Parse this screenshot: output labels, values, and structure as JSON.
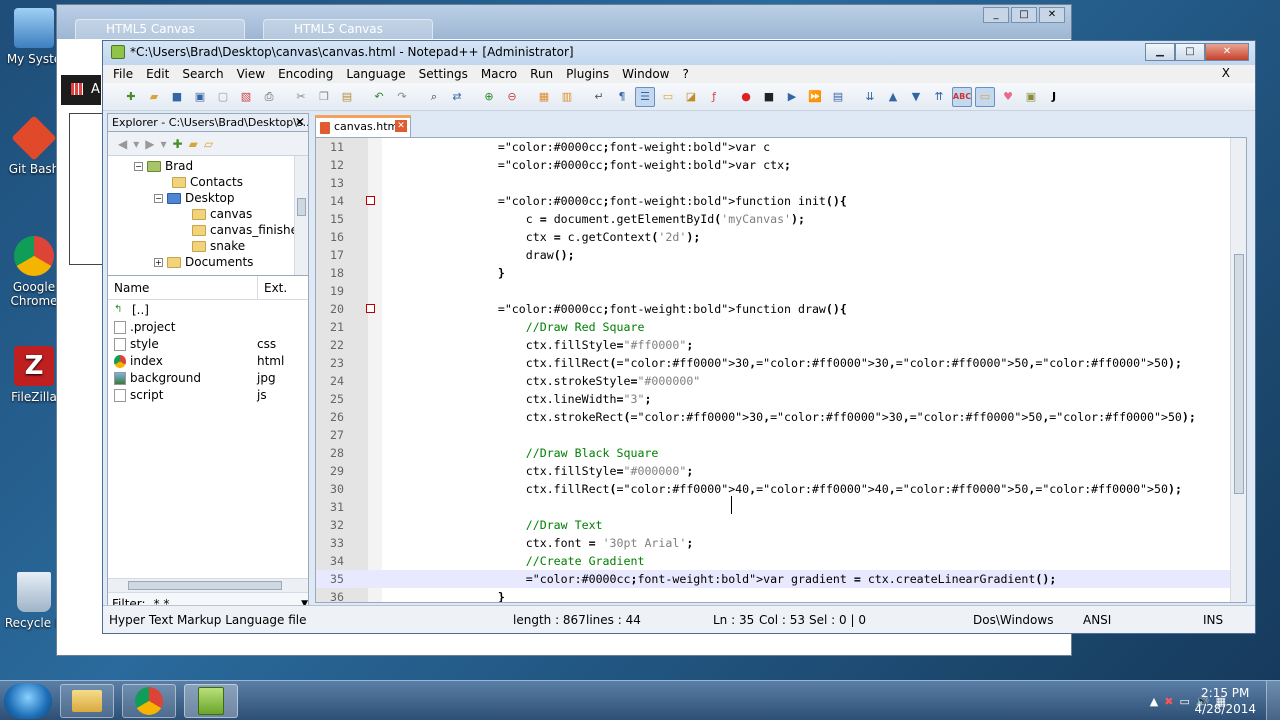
{
  "desktop": {
    "icons": [
      {
        "label": "My Syste",
        "icon": "computer-icon"
      },
      {
        "label": "Git Bash",
        "icon": "git-icon"
      },
      {
        "label": "Google Chrome",
        "icon": "chrome-icon"
      },
      {
        "label": "FileZilla",
        "icon": "filezilla-icon"
      },
      {
        "label": "Recycle B",
        "icon": "recycle-bin-icon"
      }
    ]
  },
  "browser": {
    "tab1": "HTML5 Canvas",
    "tab2": "HTML5 Canvas",
    "side_text": "Ap"
  },
  "npp": {
    "title": "*C:\\Users\\Brad\\Desktop\\canvas\\canvas.html - Notepad++ [Administrator]",
    "menus": [
      "File",
      "Edit",
      "Search",
      "View",
      "Encoding",
      "Language",
      "Settings",
      "Macro",
      "Run",
      "Plugins",
      "Window",
      "?"
    ],
    "menu_close": "X",
    "explorer": {
      "header": "Explorer - C:\\Users\\Brad\\Desktop\\s...",
      "tree": [
        {
          "label": "Brad",
          "level": 0
        },
        {
          "label": "Contacts",
          "level": 1
        },
        {
          "label": "Desktop",
          "level": 1
        },
        {
          "label": "canvas",
          "level": 2
        },
        {
          "label": "canvas_finished",
          "level": 2
        },
        {
          "label": "snake",
          "level": 2
        },
        {
          "label": "Documents",
          "level": 1
        }
      ],
      "col_name": "Name",
      "col_ext": "Ext.",
      "files": [
        {
          "name": "[..]",
          "ext": ""
        },
        {
          "name": ".project",
          "ext": ""
        },
        {
          "name": "style",
          "ext": "css"
        },
        {
          "name": "index",
          "ext": "html"
        },
        {
          "name": "background",
          "ext": "jpg"
        },
        {
          "name": "script",
          "ext": "js"
        }
      ],
      "filter_label": "Filter:",
      "filter_value": "*.*"
    },
    "tab": "canvas.html",
    "code": [
      {
        "n": "11",
        "t": "        var c"
      },
      {
        "n": "12",
        "t": "        var ctx;"
      },
      {
        "n": "13",
        "t": ""
      },
      {
        "n": "14",
        "t": "        function init(){"
      },
      {
        "n": "15",
        "t": "            c = document.getElementById('myCanvas');"
      },
      {
        "n": "16",
        "t": "            ctx = c.getContext('2d');"
      },
      {
        "n": "17",
        "t": "            draw();"
      },
      {
        "n": "18",
        "t": "        }"
      },
      {
        "n": "19",
        "t": ""
      },
      {
        "n": "20",
        "t": "        function draw(){"
      },
      {
        "n": "21",
        "t": "            //Draw Red Square"
      },
      {
        "n": "22",
        "t": "            ctx.fillStyle=\"#ff0000\";"
      },
      {
        "n": "23",
        "t": "            ctx.fillRect(30,30,50,50);"
      },
      {
        "n": "24",
        "t": "            ctx.strokeStyle=\"#000000\""
      },
      {
        "n": "25",
        "t": "            ctx.lineWidth=\"3\";"
      },
      {
        "n": "26",
        "t": "            ctx.strokeRect(30,30,50,50);"
      },
      {
        "n": "27",
        "t": ""
      },
      {
        "n": "28",
        "t": "            //Draw Black Square"
      },
      {
        "n": "29",
        "t": "            ctx.fillStyle=\"#000000\";"
      },
      {
        "n": "30",
        "t": "            ctx.fillRect(40,40,50,50);"
      },
      {
        "n": "31",
        "t": ""
      },
      {
        "n": "32",
        "t": "            //Draw Text"
      },
      {
        "n": "33",
        "t": "            ctx.font = '30pt Arial';"
      },
      {
        "n": "34",
        "t": "            //Create Gradient"
      },
      {
        "n": "35",
        "t": "            var gradient = ctx.createLinearGradient();"
      },
      {
        "n": "36",
        "t": "        }"
      }
    ],
    "status": {
      "type": "Hyper Text Markup Language file",
      "length": "length : 867",
      "lines": "lines : 44",
      "ln": "Ln : 35",
      "col": "Col : 53",
      "sel": "Sel : 0 | 0",
      "eol": "Dos\\Windows",
      "enc": "ANSI",
      "ins": "INS"
    }
  },
  "taskbar": {
    "time": "2:15 PM",
    "date": "4/28/2014"
  },
  "colors": {
    "keyword": "#0000cc",
    "comment": "#008000",
    "string": "#808080",
    "number": "#ff0000",
    "current_line": "#e8e8ff"
  }
}
